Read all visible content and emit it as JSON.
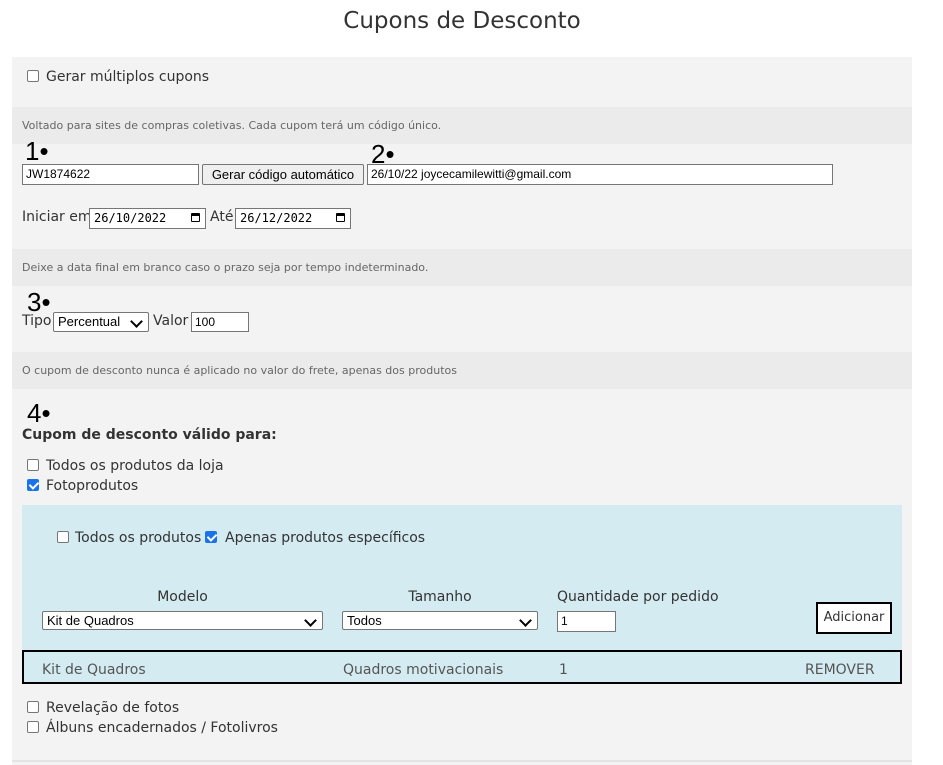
{
  "page": {
    "title": "Cupons de Desconto"
  },
  "multiple": {
    "label": "Gerar múltiplos cupons",
    "checked": false
  },
  "notes": {
    "collective": "Voltado para sites de compras coletivas. Cada cupom terá um código único.",
    "end_date": "Deixe a data final em branco caso o prazo seja por tempo indeterminado.",
    "shipping": "O cupom de desconto nunca é aplicado no valor do frete, apenas dos produtos"
  },
  "markers": {
    "m1": "1•",
    "m2": "2•",
    "m3": "3•",
    "m4": "4•"
  },
  "code": {
    "value": "JW1874622",
    "generate_button": "Gerar código automático"
  },
  "description": {
    "value": "26/10/22 joycecamilewitti@gmail.com"
  },
  "dates": {
    "start_label": "Iniciar em",
    "start_value": "26/10/2022",
    "end_label": "Até",
    "end_value": "26/12/2022"
  },
  "discount": {
    "type_label": "Tipo",
    "type_value": "Percentual",
    "value_label": "Valor",
    "value": "100"
  },
  "validity": {
    "heading": "Cupom de desconto válido para:",
    "all_products": "Todos os produtos da loja",
    "fotoprodutos": "Fotoprodutos",
    "revelacao": "Revelação de fotos",
    "albuns": "Álbuns encadernados / Fotolivros"
  },
  "fotoprodutos_panel": {
    "all_label": "Todos os produtos",
    "specific_label": "Apenas produtos específicos",
    "col_model": "Modelo",
    "col_size": "Tamanho",
    "col_qty": "Quantidade por pedido",
    "model_value": "Kit de Quadros",
    "size_value": "Todos",
    "qty_value": "1",
    "add_button": "Adicionar",
    "row": {
      "model": "Kit de Quadros",
      "size": "Quadros motivacionais",
      "qty": "1",
      "remove": "REMOVER"
    }
  },
  "colors": {
    "check_blue": "#1a73e8",
    "panel_blue": "#d4ebf2",
    "panel_gray": "#f3f3f3",
    "note_gray": "#ebebeb"
  }
}
